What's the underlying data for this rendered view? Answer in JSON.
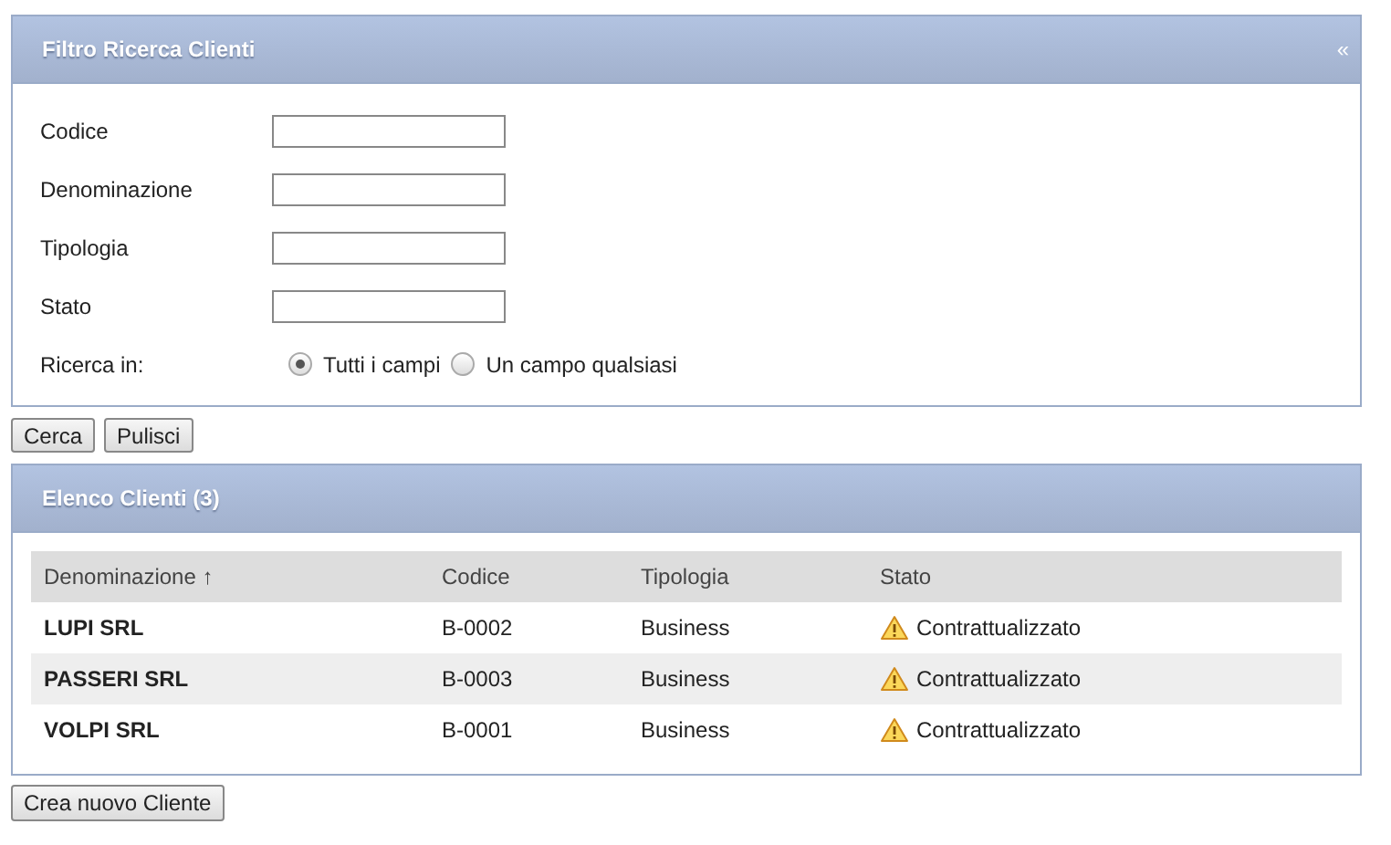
{
  "filter_panel": {
    "title": "Filtro Ricerca Clienti",
    "collapse": "«",
    "fields": [
      {
        "label": "Codice"
      },
      {
        "label": "Denominazione"
      },
      {
        "label": "Tipologia"
      },
      {
        "label": "Stato"
      }
    ],
    "search_in": {
      "label": "Ricerca in:",
      "options": [
        {
          "label": "Tutti i campi",
          "selected": true
        },
        {
          "label": "Un campo qualsiasi",
          "selected": false
        }
      ]
    }
  },
  "filter_buttons": [
    "Cerca",
    "Pulisci"
  ],
  "list_panel": {
    "title": "Elenco Clienti (3)",
    "table": {
      "columns": [
        "Denominazione ↑",
        "Codice",
        "Tipologia",
        "Stato"
      ],
      "rows": [
        {
          "cells": [
            "LUPI SRL",
            "B-0002",
            "Business",
            "Contrattualizzato"
          ]
        },
        {
          "cells": [
            "PASSERI SRL",
            "B-0003",
            "Business",
            "Contrattualizzato"
          ]
        },
        {
          "cells": [
            "VOLPI SRL",
            "B-0001",
            "Business",
            "Contrattualizzato"
          ]
        }
      ]
    }
  },
  "bottom_button": "Crea nuovo Cliente"
}
